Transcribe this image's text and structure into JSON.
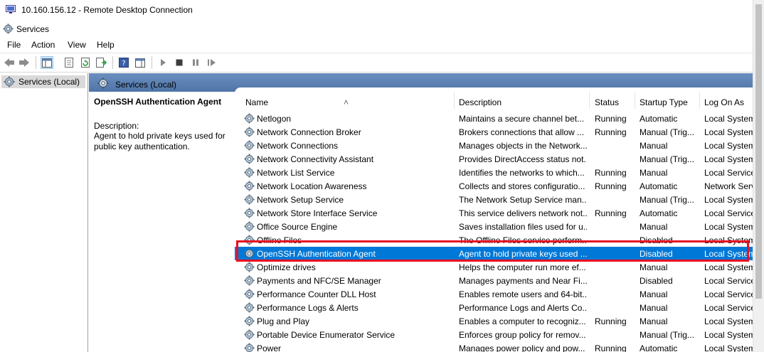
{
  "window": {
    "title": "10.160.156.12 - Remote Desktop Connection"
  },
  "app": {
    "name": "Services"
  },
  "menu": [
    "File",
    "Action",
    "View",
    "Help"
  ],
  "tree": {
    "root": "Services (Local)"
  },
  "panel": {
    "header": "Services (Local)",
    "selected_name": "OpenSSH Authentication Agent",
    "description_label": "Description:",
    "description": "Agent to hold private keys used for public key authentication."
  },
  "columns": [
    "Name",
    "Description",
    "Status",
    "Startup Type",
    "Log On As"
  ],
  "services": [
    {
      "name": "Netlogon",
      "description": "Maintains a secure channel bet...",
      "status": "Running",
      "startup": "Automatic",
      "logon": "Local System"
    },
    {
      "name": "Network Connection Broker",
      "description": "Brokers connections that allow ...",
      "status": "Running",
      "startup": "Manual (Trig...",
      "logon": "Local System"
    },
    {
      "name": "Network Connections",
      "description": "Manages objects in the Network...",
      "status": "",
      "startup": "Manual",
      "logon": "Local System"
    },
    {
      "name": "Network Connectivity Assistant",
      "description": "Provides DirectAccess status not...",
      "status": "",
      "startup": "Manual (Trig...",
      "logon": "Local System"
    },
    {
      "name": "Network List Service",
      "description": "Identifies the networks to which...",
      "status": "Running",
      "startup": "Manual",
      "logon": "Local Service"
    },
    {
      "name": "Network Location Awareness",
      "description": "Collects and stores configuratio...",
      "status": "Running",
      "startup": "Automatic",
      "logon": "Network Service"
    },
    {
      "name": "Network Setup Service",
      "description": "The Network Setup Service man...",
      "status": "",
      "startup": "Manual (Trig...",
      "logon": "Local System"
    },
    {
      "name": "Network Store Interface Service",
      "description": "This service delivers network not...",
      "status": "Running",
      "startup": "Automatic",
      "logon": "Local Service"
    },
    {
      "name": "Office  Source Engine",
      "description": "Saves installation files used for u...",
      "status": "",
      "startup": "Manual",
      "logon": "Local System"
    },
    {
      "name": "Offline Files",
      "description": "The Offline Files service perform...",
      "status": "",
      "startup": "Disabled",
      "logon": "Local System"
    },
    {
      "name": "OpenSSH Authentication Agent",
      "description": "Agent to hold private keys used ...",
      "status": "",
      "startup": "Disabled",
      "logon": "Local System",
      "selected": true
    },
    {
      "name": "Optimize drives",
      "description": "Helps the computer run more ef...",
      "status": "",
      "startup": "Manual",
      "logon": "Local System"
    },
    {
      "name": "Payments and NFC/SE Manager",
      "description": "Manages payments and Near Fi...",
      "status": "",
      "startup": "Disabled",
      "logon": "Local Service"
    },
    {
      "name": "Performance Counter DLL Host",
      "description": "Enables remote users and 64-bit...",
      "status": "",
      "startup": "Manual",
      "logon": "Local Service"
    },
    {
      "name": "Performance Logs & Alerts",
      "description": "Performance Logs and Alerts Co...",
      "status": "",
      "startup": "Manual",
      "logon": "Local Service"
    },
    {
      "name": "Plug and Play",
      "description": "Enables a computer to recogniz...",
      "status": "Running",
      "startup": "Manual",
      "logon": "Local System"
    },
    {
      "name": "Portable Device Enumerator Service",
      "description": "Enforces group policy for remov...",
      "status": "",
      "startup": "Manual (Trig...",
      "logon": "Local System"
    },
    {
      "name": "Power",
      "description": "Manages power policy and pow...",
      "status": "Running",
      "startup": "Automatic",
      "logon": "Local System"
    }
  ],
  "colors": {
    "selection": "#0078d7",
    "annotation_box": "#e81123",
    "header_band": "#5b7fb0"
  }
}
